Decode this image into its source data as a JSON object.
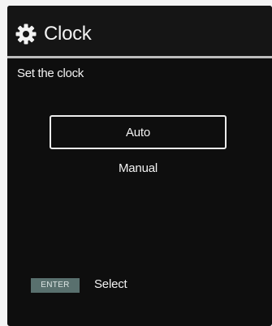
{
  "header": {
    "icon": "gear-icon",
    "title": "Clock"
  },
  "prompt": "Set the clock",
  "options": [
    {
      "label": "Auto",
      "selected": true
    },
    {
      "label": "Manual",
      "selected": false
    }
  ],
  "footer": {
    "key_label": "ENTER",
    "action_label": "Select"
  },
  "colors": {
    "background": "#0e0e0e",
    "text": "#f2f2f2",
    "divider": "#bdbdbd",
    "key_badge": "#59706e"
  }
}
